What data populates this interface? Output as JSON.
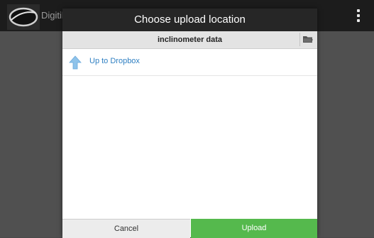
{
  "app": {
    "title": "Digitilt",
    "logo_icon": "digitilt-logo-icon",
    "menu_icon": "overflow-menu-icon"
  },
  "dialog": {
    "title": "Choose upload location",
    "current_folder": "inclinometer data",
    "new_folder_icon": "folder-icon",
    "items": [
      {
        "label": "Up to Dropbox",
        "icon": "up-arrow-icon"
      }
    ],
    "cancel_label": "Cancel",
    "upload_label": "Upload"
  },
  "colors": {
    "header_bg": "#262626",
    "link_blue": "#2e7fc2",
    "upload_green": "#55b94d",
    "arrow_blue": "#8fc3ea"
  }
}
